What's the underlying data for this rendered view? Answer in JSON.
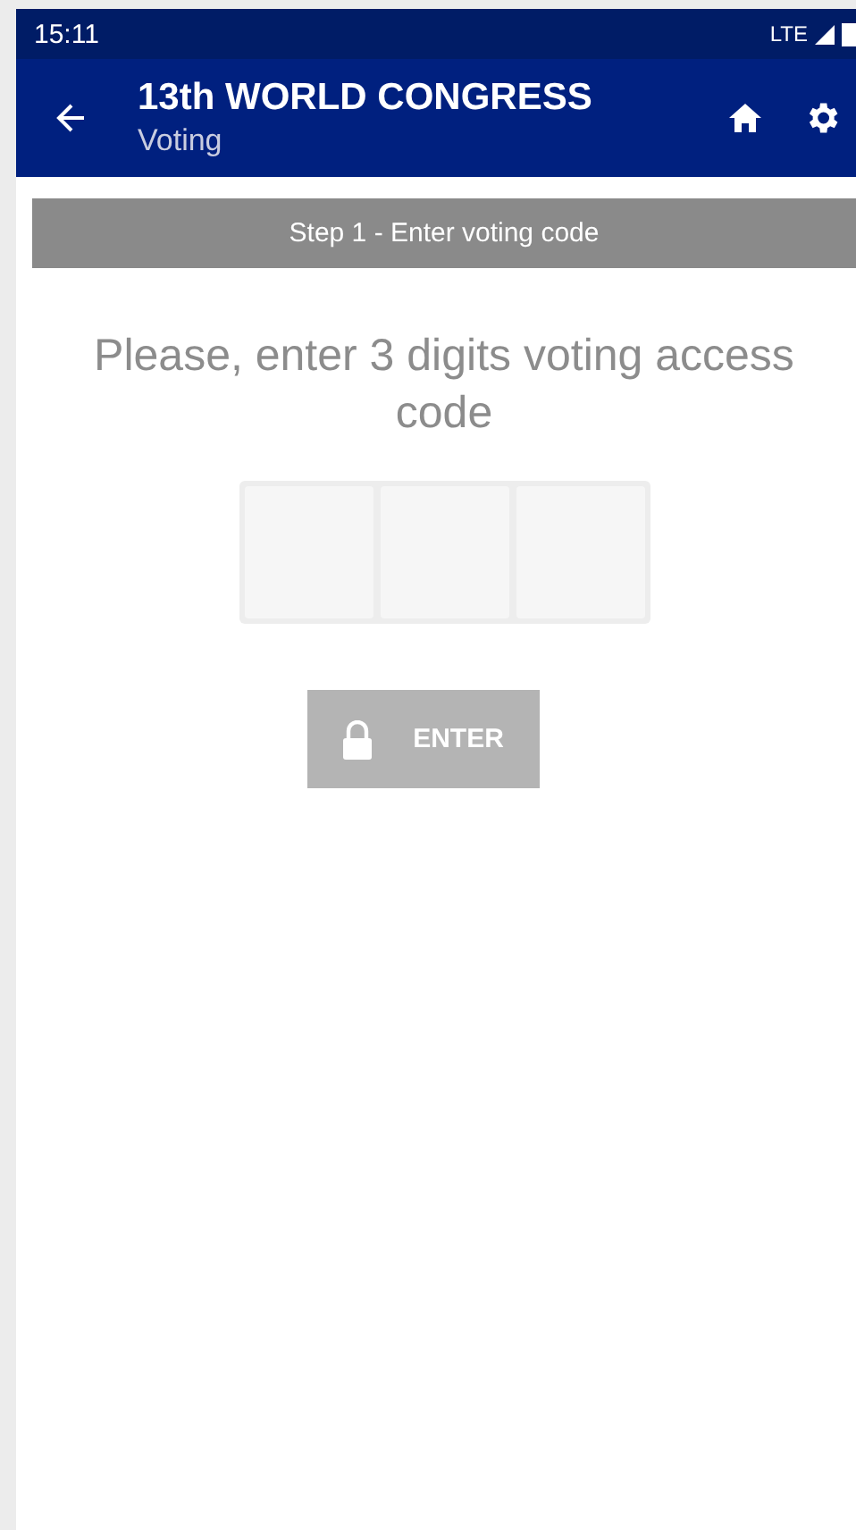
{
  "status_bar": {
    "time": "15:11",
    "network": "LTE"
  },
  "app_bar": {
    "title": "13th WORLD CONGRESS",
    "subtitle": "Voting"
  },
  "step_banner": "Step 1 - Enter voting code",
  "prompt": "Please, enter 3 digits voting access code",
  "digit_fields": [
    {
      "kind": "digit"
    },
    {
      "kind": "digit"
    },
    {
      "kind": "digit"
    }
  ],
  "enter_button": {
    "label": "ENTER",
    "disabled": true
  }
}
